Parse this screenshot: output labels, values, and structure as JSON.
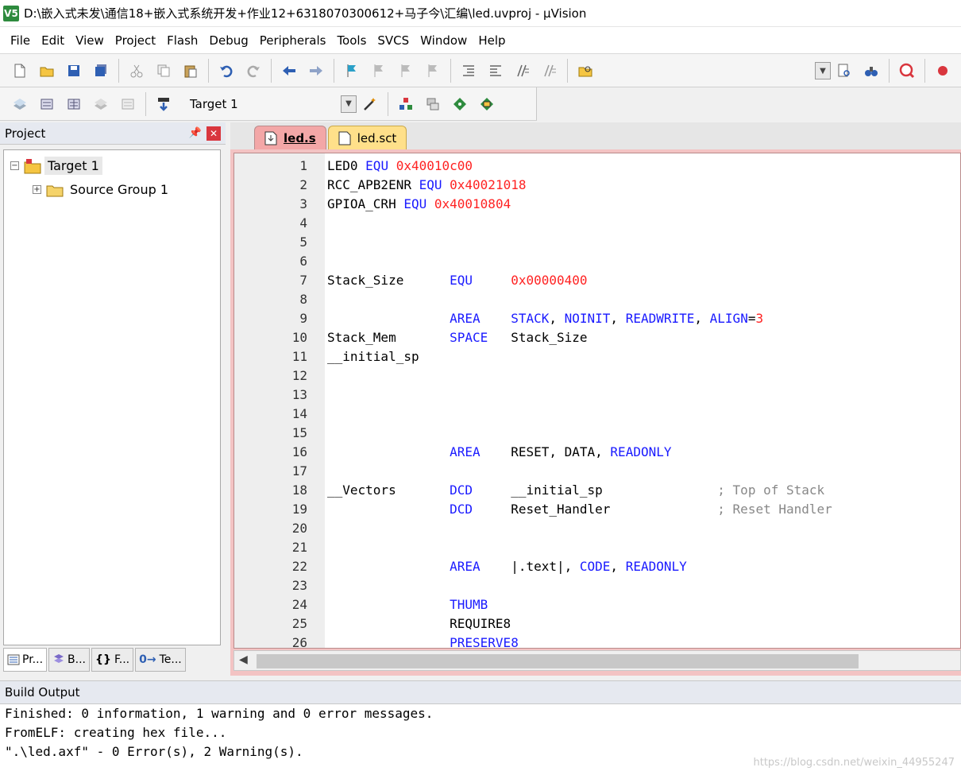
{
  "window": {
    "title": "D:\\嵌入式未发\\通信18+嵌入式系统开发+作业12+6318070300612+马子今\\汇编\\led.uvproj - μVision",
    "app_icon": "V5"
  },
  "menu": [
    "File",
    "Edit",
    "View",
    "Project",
    "Flash",
    "Debug",
    "Peripherals",
    "Tools",
    "SVCS",
    "Window",
    "Help"
  ],
  "toolbar2": {
    "target_value": "Target 1"
  },
  "project_panel": {
    "title": "Project",
    "tree": {
      "target": "Target 1",
      "group": "Source Group 1"
    },
    "tabs": [
      "Pr...",
      "B...",
      "F...",
      "Te..."
    ]
  },
  "editor": {
    "tabs": [
      {
        "label": "led.s",
        "active": true
      },
      {
        "label": "led.sct",
        "active": false
      }
    ],
    "lines": [
      {
        "n": "1",
        "parts": [
          [
            "LED0 ",
            ""
          ],
          [
            "EQU",
            "kw"
          ],
          [
            " ",
            ""
          ],
          [
            "0x40010c00",
            "num"
          ]
        ]
      },
      {
        "n": "2",
        "parts": [
          [
            "RCC_APB2ENR ",
            ""
          ],
          [
            "EQU",
            "kw"
          ],
          [
            " ",
            ""
          ],
          [
            "0x40021018",
            "num"
          ]
        ]
      },
      {
        "n": "3",
        "parts": [
          [
            "GPIOA_CRH ",
            ""
          ],
          [
            "EQU",
            "kw"
          ],
          [
            " ",
            ""
          ],
          [
            "0x40010804",
            "num"
          ]
        ]
      },
      {
        "n": "4",
        "parts": []
      },
      {
        "n": "5",
        "parts": []
      },
      {
        "n": "6",
        "parts": []
      },
      {
        "n": "7",
        "parts": [
          [
            "Stack_Size      ",
            ""
          ],
          [
            "EQU",
            "kw"
          ],
          [
            "     ",
            ""
          ],
          [
            "0x00000400",
            "num"
          ]
        ]
      },
      {
        "n": "8",
        "parts": []
      },
      {
        "n": "9",
        "parts": [
          [
            "                ",
            ""
          ],
          [
            "AREA",
            "kw"
          ],
          [
            "    ",
            ""
          ],
          [
            "STACK",
            "kw"
          ],
          [
            ", ",
            ""
          ],
          [
            "NOINIT",
            "kw"
          ],
          [
            ", ",
            ""
          ],
          [
            "READWRITE",
            "kw"
          ],
          [
            ", ",
            ""
          ],
          [
            "ALIGN",
            "kw"
          ],
          [
            "=",
            ""
          ],
          [
            "3",
            "num"
          ]
        ]
      },
      {
        "n": "10",
        "parts": [
          [
            "Stack_Mem       ",
            ""
          ],
          [
            "SPACE",
            "kw"
          ],
          [
            "   Stack_Size",
            ""
          ]
        ]
      },
      {
        "n": "11",
        "parts": [
          [
            "__initial_sp",
            ""
          ]
        ]
      },
      {
        "n": "12",
        "parts": []
      },
      {
        "n": "13",
        "parts": []
      },
      {
        "n": "14",
        "parts": []
      },
      {
        "n": "15",
        "parts": []
      },
      {
        "n": "16",
        "parts": [
          [
            "                ",
            ""
          ],
          [
            "AREA",
            "kw"
          ],
          [
            "    RESET, DATA, ",
            ""
          ],
          [
            "READONLY",
            "kw"
          ]
        ]
      },
      {
        "n": "17",
        "parts": []
      },
      {
        "n": "18",
        "parts": [
          [
            "__Vectors       ",
            ""
          ],
          [
            "DCD",
            "kw"
          ],
          [
            "     __initial_sp               ",
            ""
          ],
          [
            "; Top of Stack",
            "cm"
          ]
        ]
      },
      {
        "n": "19",
        "parts": [
          [
            "                ",
            ""
          ],
          [
            "DCD",
            "kw"
          ],
          [
            "     Reset_Handler              ",
            ""
          ],
          [
            "; Reset Handler",
            "cm"
          ]
        ]
      },
      {
        "n": "20",
        "parts": []
      },
      {
        "n": "21",
        "parts": []
      },
      {
        "n": "22",
        "parts": [
          [
            "                ",
            ""
          ],
          [
            "AREA",
            "kw"
          ],
          [
            "    |.text|, ",
            ""
          ],
          [
            "CODE",
            "kw"
          ],
          [
            ", ",
            ""
          ],
          [
            "READONLY",
            "kw"
          ]
        ]
      },
      {
        "n": "23",
        "parts": []
      },
      {
        "n": "24",
        "parts": [
          [
            "                ",
            ""
          ],
          [
            "THUMB",
            "kw"
          ]
        ]
      },
      {
        "n": "25",
        "parts": [
          [
            "                REQUIRE8",
            ""
          ]
        ]
      },
      {
        "n": "26",
        "parts": [
          [
            "                ",
            ""
          ],
          [
            "PRESERVE8",
            "kw"
          ]
        ]
      }
    ]
  },
  "build_output": {
    "title": "Build Output",
    "lines": [
      "Finished: 0 information, 1 warning and 0 error messages.",
      "FromELF: creating hex file...",
      "\".\\led.axf\" - 0 Error(s), 2 Warning(s)."
    ]
  },
  "watermark": "https://blog.csdn.net/weixin_44955247",
  "colors": {
    "keyword": "#1a1aff",
    "number": "#ff2222",
    "comment": "#888888",
    "active_tab": "#f3a7a7",
    "inactive_tab": "#ffe08a"
  }
}
